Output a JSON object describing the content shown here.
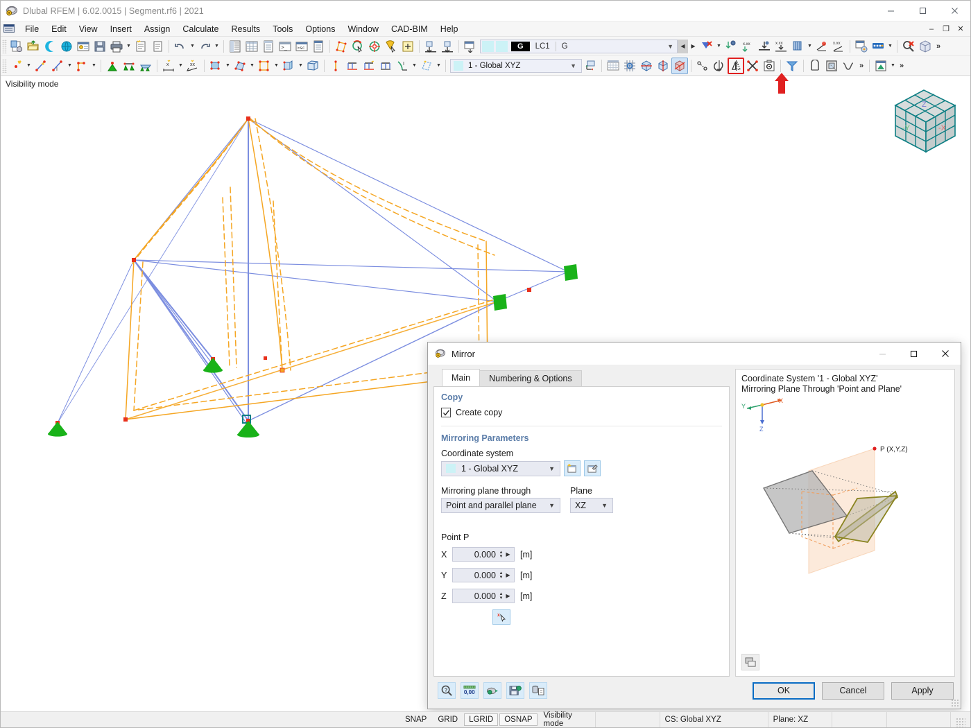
{
  "window": {
    "title": "Dlubal RFEM | 6.02.0015 | Segment.rf6 | 2021",
    "app_icon": "rfem-logo-icon",
    "minimize": "minimize-icon",
    "maximize": "maximize-icon",
    "close": "close-icon"
  },
  "menu": {
    "items": [
      "File",
      "Edit",
      "View",
      "Insert",
      "Assign",
      "Calculate",
      "Results",
      "Tools",
      "Options",
      "Window",
      "CAD-BIM",
      "Help"
    ],
    "mdi": {
      "minimize": "–",
      "restore": "❐",
      "close": "✕"
    }
  },
  "toolbar_loadcase": {
    "badge": "G",
    "case_id": "LC1",
    "case_name": "G",
    "caret": "chevron-down-icon"
  },
  "toolbar_cs": {
    "value": "1 - Global XYZ",
    "caret": "chevron-down-icon"
  },
  "viewport": {
    "mode_label": "Visibility mode",
    "navcube": {
      "face_x": "-X",
      "face_y": "-Y",
      "face_z": "Z"
    }
  },
  "dialog": {
    "title": "Mirror",
    "icon": "mirror-dialog-icon",
    "titlebar": {
      "minimize": "–",
      "maximize": "❐",
      "close": "✕"
    },
    "tabs": [
      {
        "label": "Main",
        "active": true
      },
      {
        "label": "Numbering & Options",
        "active": false
      }
    ],
    "copy_group": {
      "title": "Copy",
      "create_copy_label": "Create copy",
      "create_copy_checked": true
    },
    "params_group": {
      "title": "Mirroring Parameters",
      "coordinate_system_label": "Coordinate system",
      "coordinate_system_value": "1 - Global XYZ",
      "new_cs_button": "new-coordinate-system-icon",
      "edit_cs_button": "edit-coordinate-system-icon",
      "plane_through_label": "Mirroring plane through",
      "plane_through_value": "Point and parallel plane",
      "plane_label": "Plane",
      "plane_value": "XZ",
      "point_label": "Point P",
      "coords": [
        {
          "axis": "X",
          "value": "0.000",
          "unit": "[m]"
        },
        {
          "axis": "Y",
          "value": "0.000",
          "unit": "[m]"
        },
        {
          "axis": "Z",
          "value": "0.000",
          "unit": "[m]"
        }
      ],
      "pick_button": "pick-point-in-view-icon"
    },
    "preview": {
      "line1": "Coordinate System '1 - Global XYZ'",
      "line2": "Mirroring Plane Through 'Point and Plane'",
      "axis_x": "X",
      "axis_y": "Y",
      "axis_z": "Z",
      "point_label": "P (X,Y,Z)",
      "camera_button": "preview-camera-icon"
    },
    "footer_tools": [
      "help-icon",
      "units-and-decimal-places-icon",
      "settings-icon",
      "save-defaults-icon",
      "load-defaults-icon"
    ],
    "buttons": {
      "ok": "OK",
      "cancel": "Cancel",
      "apply": "Apply"
    }
  },
  "statusbar": {
    "toggles": [
      {
        "label": "SNAP",
        "on": false
      },
      {
        "label": "GRID",
        "on": false
      },
      {
        "label": "LGRID",
        "on": true
      },
      {
        "label": "OSNAP",
        "on": true
      }
    ],
    "mode": "Visibility mode",
    "cs": "CS: Global XYZ",
    "plane": "Plane: XZ"
  },
  "colors": {
    "member_blue": "#7c8ee0",
    "member_orange": "#f5a623",
    "node_red": "#e8301b",
    "support_green": "#19b219",
    "highlight_red": "#e02020",
    "accent_blue": "#0a6cc4",
    "group_heading": "#5a7ca8"
  }
}
